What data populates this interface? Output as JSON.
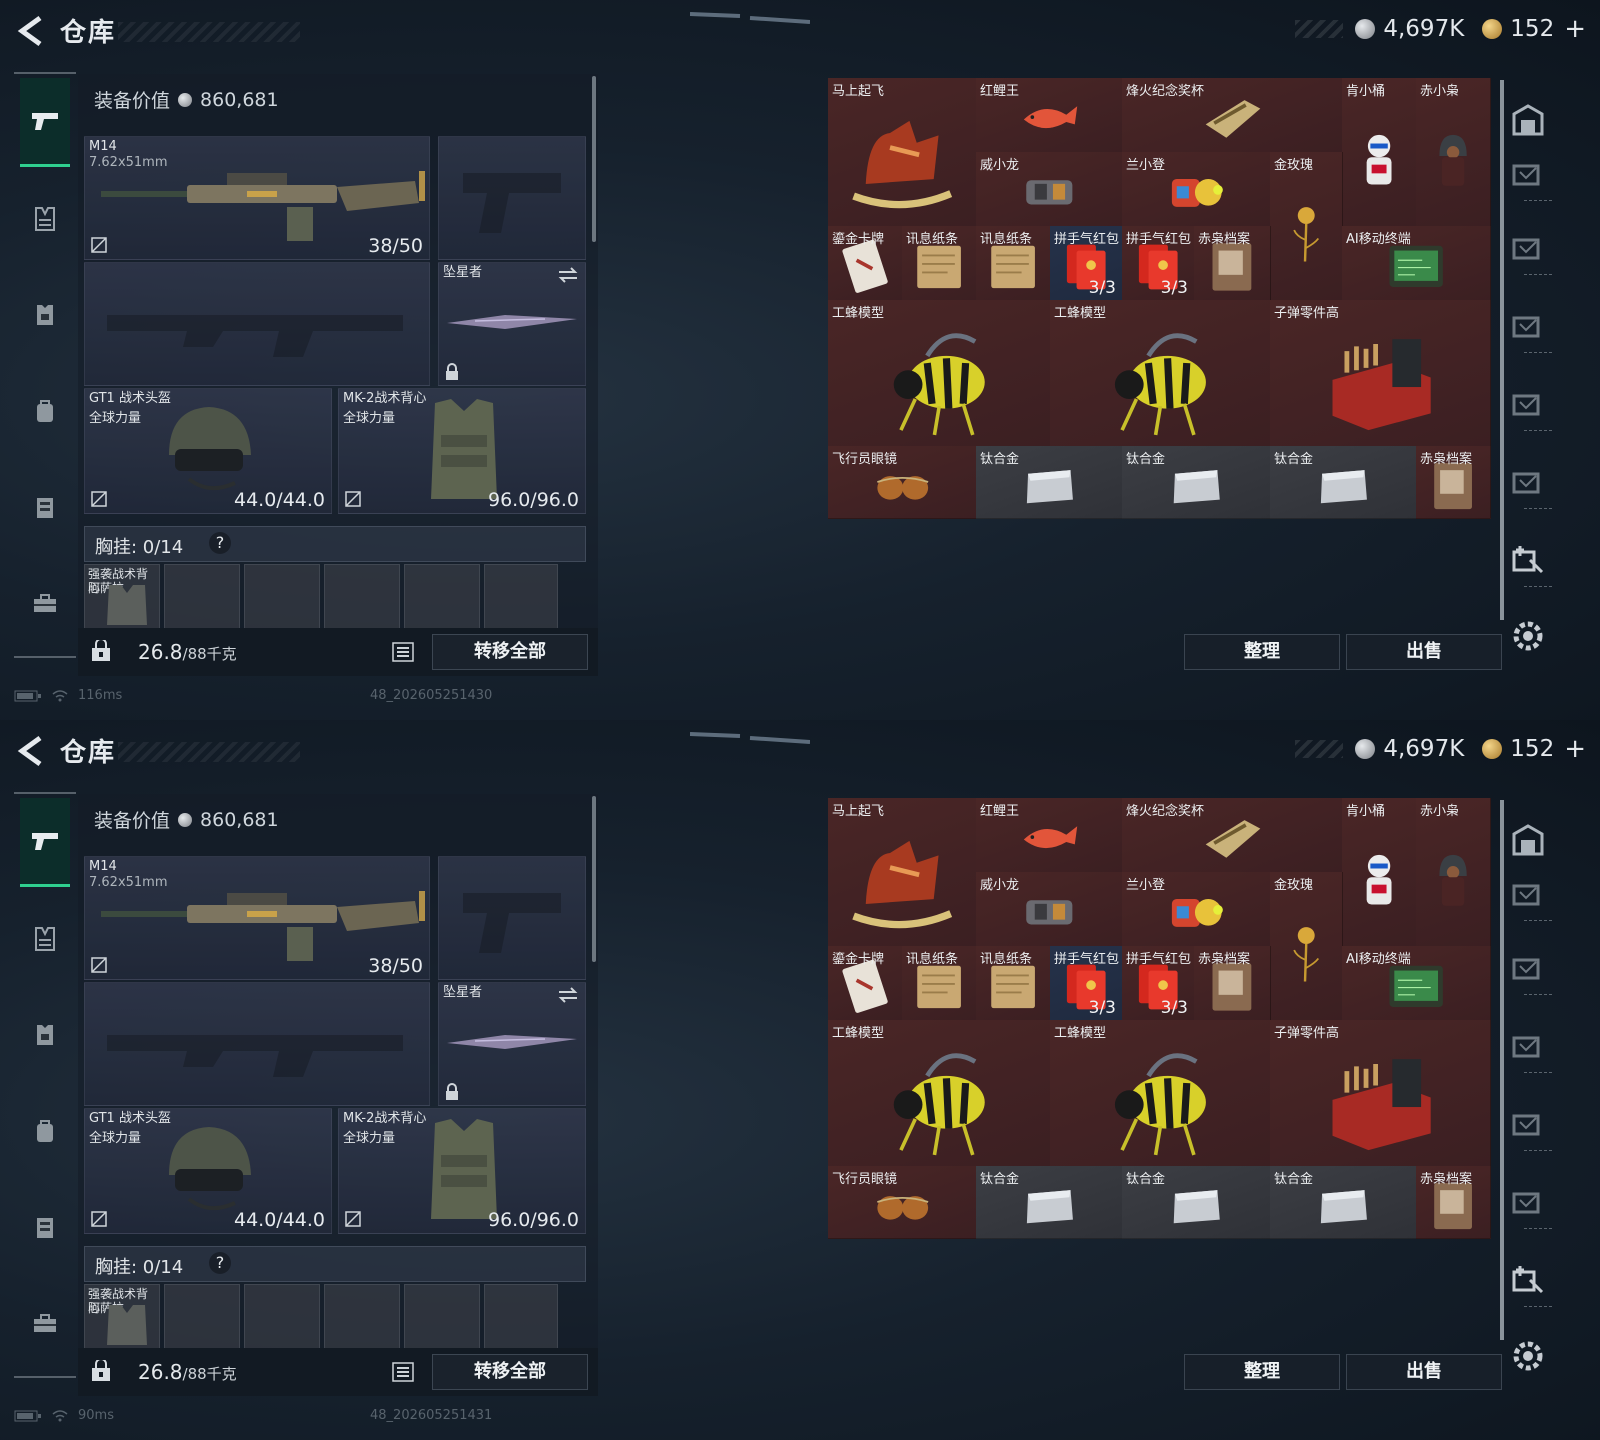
{
  "screens": [
    {
      "title": "仓库",
      "currency": {
        "silver": "4,697K",
        "gold": "152",
        "gold_plus": "+"
      },
      "equip_value": {
        "label": "装备价值",
        "amount": "860,681"
      },
      "primary_weapon": {
        "name": "M14",
        "ammo_type": "7.62x51mm",
        "ammo": "38/50"
      },
      "melee": {
        "name": "坠星者"
      },
      "helmet": {
        "name": "GT1 战术头盔",
        "brand": "全球力量",
        "durability": "44.0/44.0"
      },
      "armor": {
        "name": "MK-2战术背心",
        "brand": "全球力量",
        "durability": "96.0/96.0"
      },
      "chest_rig": {
        "label": "胸挂: 0/14",
        "help": "?"
      },
      "rig_pouch": {
        "name": "强袭战术背心",
        "brand": "阿萨拉"
      },
      "footer": {
        "weight": "26.8",
        "capacity": "/88千克",
        "transfer_all": "转移全部"
      },
      "status": {
        "ping": "116ms",
        "build": "48_202605251430"
      },
      "buttons": {
        "sort": "整理",
        "sell": "出售"
      }
    },
    {
      "title": "仓库",
      "currency": {
        "silver": "4,697K",
        "gold": "152",
        "gold_plus": "+"
      },
      "equip_value": {
        "label": "装备价值",
        "amount": "860,681"
      },
      "primary_weapon": {
        "name": "M14",
        "ammo_type": "7.62x51mm",
        "ammo": "38/50"
      },
      "melee": {
        "name": "坠星者"
      },
      "helmet": {
        "name": "GT1 战术头盔",
        "brand": "全球力量",
        "durability": "44.0/44.0"
      },
      "armor": {
        "name": "MK-2战术背心",
        "brand": "全球力量",
        "durability": "96.0/96.0"
      },
      "chest_rig": {
        "label": "胸挂: 0/14",
        "help": "?"
      },
      "rig_pouch": {
        "name": "强袭战术背心",
        "brand": "阿萨拉"
      },
      "footer": {
        "weight": "26.8",
        "capacity": "/88千克",
        "transfer_all": "转移全部"
      },
      "status": {
        "ping": "90ms",
        "build": "48_202605251431"
      },
      "buttons": {
        "sort": "整理",
        "sell": "出售"
      }
    }
  ],
  "items": [
    {
      "name": "马上起飞",
      "count": "",
      "color": "red",
      "icon": "horse-sleigh-icon"
    },
    {
      "name": "红鲤王",
      "count": "",
      "color": "red",
      "icon": "carp-icon"
    },
    {
      "name": "烽火纪念奖杯",
      "count": "",
      "color": "red",
      "icon": "trophy-icon"
    },
    {
      "name": "肯小桶",
      "count": "",
      "color": "red",
      "icon": "colonel-figure-icon"
    },
    {
      "name": "赤小枭",
      "count": "",
      "color": "red",
      "icon": "hooded-figure-icon"
    },
    {
      "name": "威小龙",
      "count": "",
      "color": "red",
      "icon": "figure-icon"
    },
    {
      "name": "兰小登",
      "count": "",
      "color": "red",
      "icon": "colorful-figure-icon"
    },
    {
      "name": "金玫瑰",
      "count": "",
      "color": "red",
      "icon": "golden-rose-icon"
    },
    {
      "name": "鎏金卡牌",
      "count": "",
      "color": "red",
      "icon": "card-icon"
    },
    {
      "name": "讯息纸条",
      "count": "",
      "color": "red",
      "icon": "note-icon"
    },
    {
      "name": "讯息纸条",
      "count": "",
      "color": "red",
      "icon": "note-icon"
    },
    {
      "name": "拼手气红包",
      "count": "3/3",
      "color": "blue",
      "icon": "red-envelope-icon"
    },
    {
      "name": "拼手气红包",
      "count": "3/3",
      "color": "red",
      "icon": "red-envelope-icon"
    },
    {
      "name": "赤枭档案",
      "count": "",
      "color": "red",
      "icon": "file-icon"
    },
    {
      "name": "AI移动终端",
      "count": "",
      "color": "red",
      "icon": "terminal-icon"
    },
    {
      "name": "工蜂模型",
      "count": "",
      "color": "red",
      "icon": "bee-model-icon"
    },
    {
      "name": "工蜂模型",
      "count": "",
      "color": "red",
      "icon": "bee-model-icon"
    },
    {
      "name": "子弹零件高",
      "count": "",
      "color": "red",
      "icon": "ammo-parts-icon"
    },
    {
      "name": "飞行员眼镜",
      "count": "",
      "color": "red",
      "icon": "aviator-glasses-icon"
    },
    {
      "name": "钛合金",
      "count": "",
      "color": "gray",
      "icon": "titanium-plate-icon"
    },
    {
      "name": "钛合金",
      "count": "",
      "color": "gray",
      "icon": "titanium-plate-icon"
    },
    {
      "name": "钛合金",
      "count": "",
      "color": "gray",
      "icon": "titanium-plate-icon"
    },
    {
      "name": "赤枭档案",
      "count": "",
      "color": "red",
      "icon": "file-icon"
    }
  ],
  "nav": {
    "left": [
      "pistol-icon",
      "vest-icon",
      "armor-icon",
      "backpack-icon",
      "locker-icon",
      "toolbox-icon"
    ],
    "right": [
      "storage-icon",
      "warehouse-icon",
      "warehouse-icon",
      "warehouse-icon",
      "warehouse-icon",
      "warehouse-icon",
      "warehouse-add-icon",
      "settings-icon"
    ]
  },
  "colors": {
    "accent": "#2fd08f",
    "rare_red": "#4a2626",
    "titanium_gray": "#3c3e44",
    "epic_blue": "#26324a"
  }
}
